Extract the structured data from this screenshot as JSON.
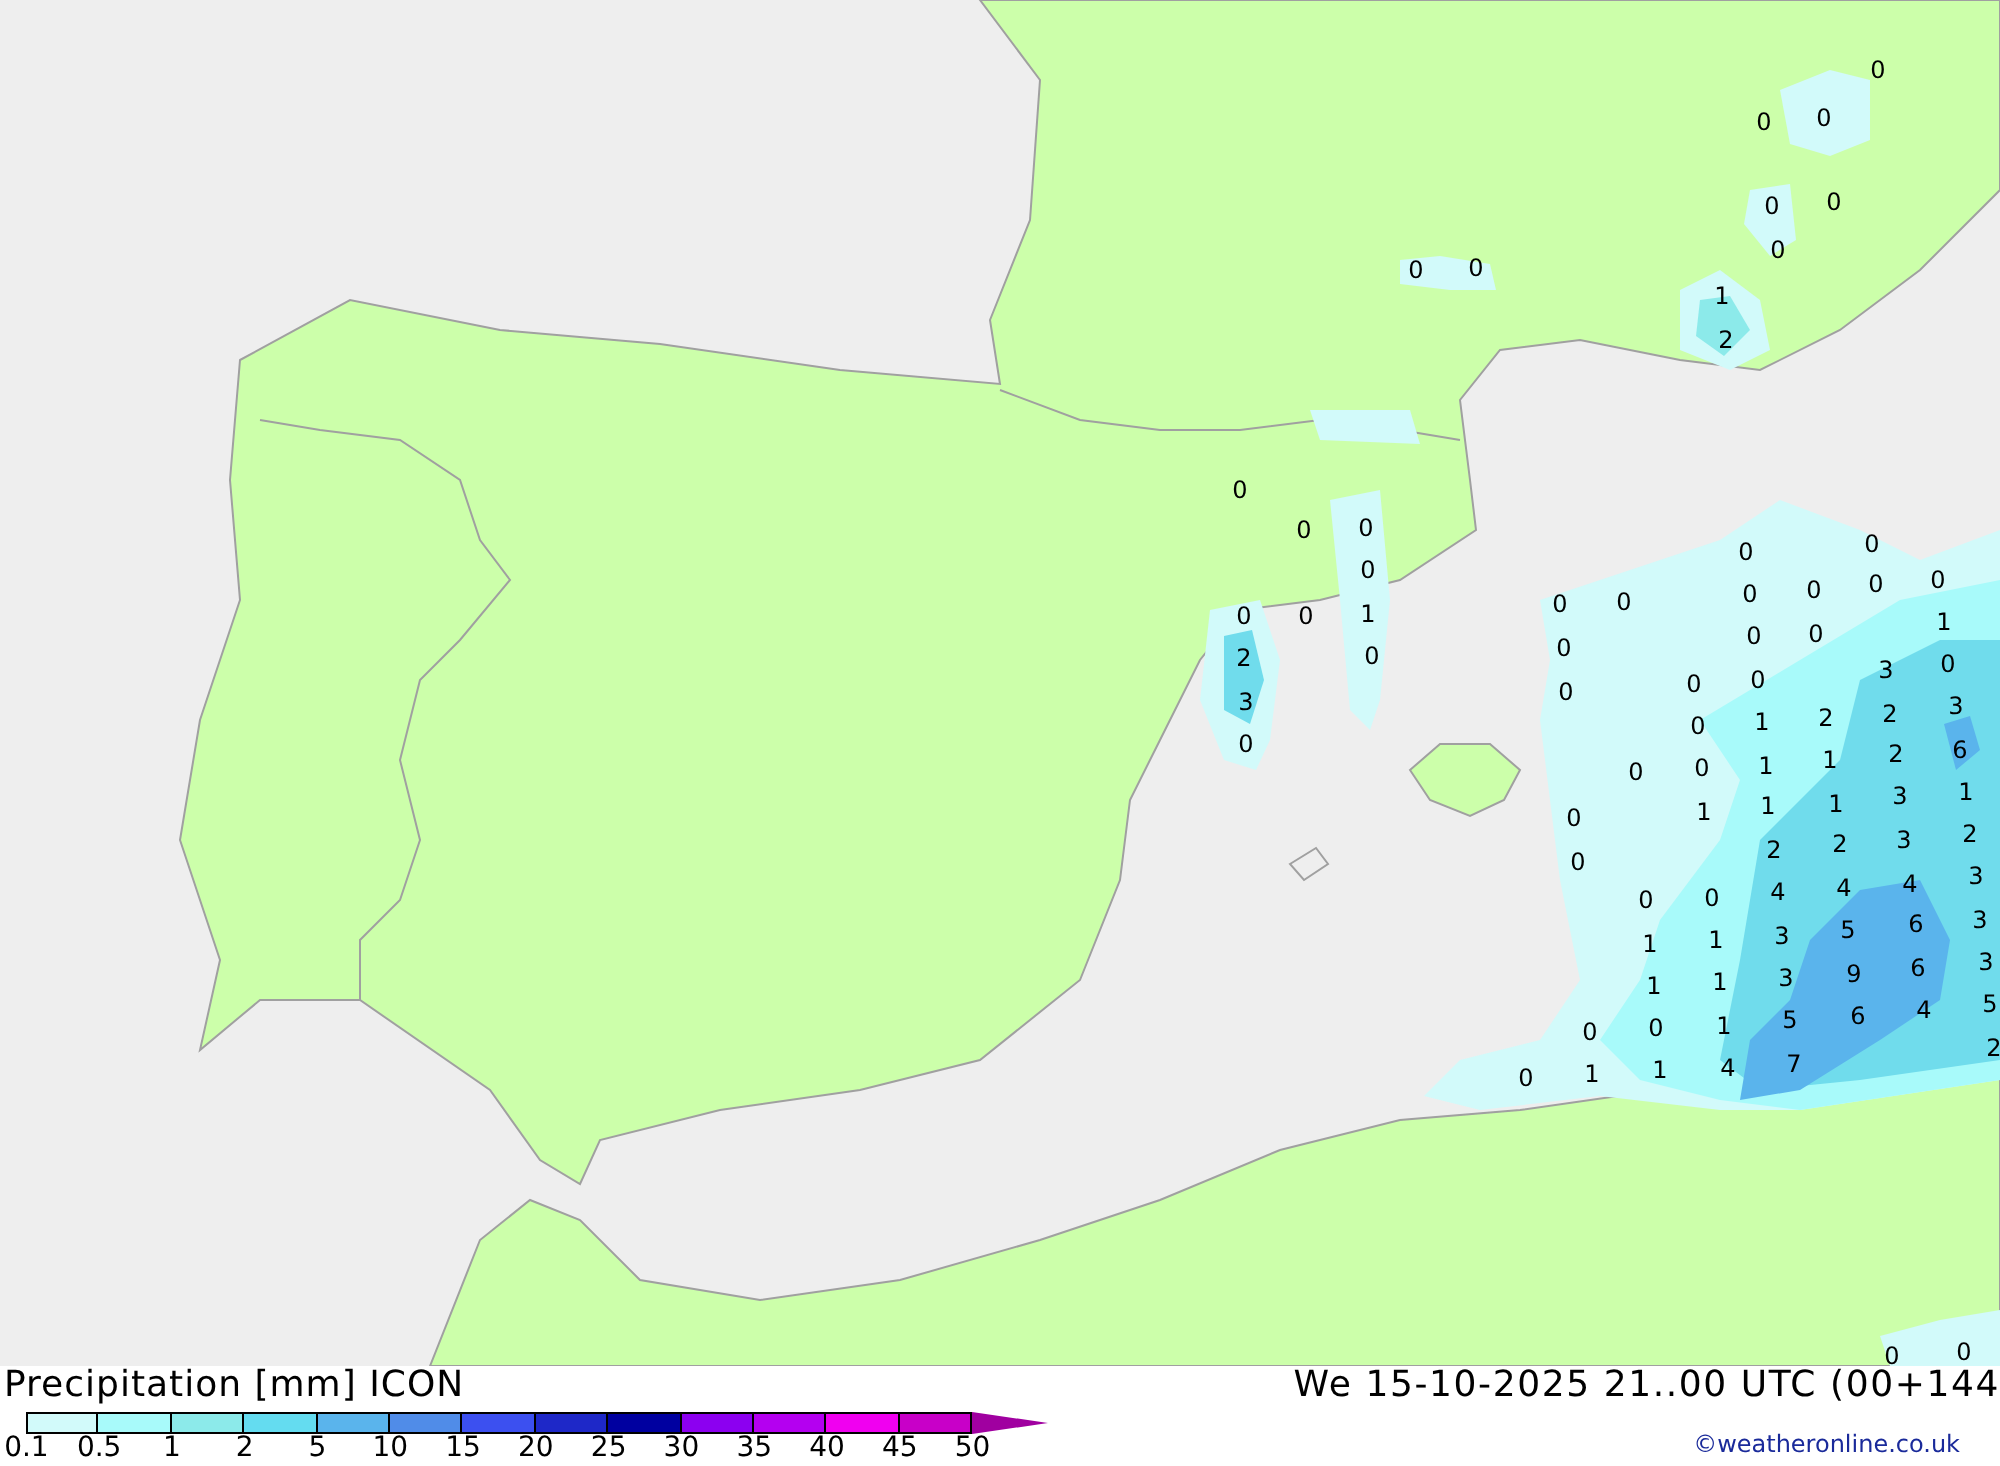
{
  "map": {
    "labels": [
      {
        "value": "0"
      },
      {
        "value": "0"
      },
      {
        "value": "0"
      },
      {
        "value": "0"
      },
      {
        "value": "0"
      },
      {
        "value": "0"
      },
      {
        "value": "0"
      },
      {
        "value": "0"
      },
      {
        "value": "1"
      },
      {
        "value": "2"
      },
      {
        "value": "0"
      },
      {
        "value": "0"
      },
      {
        "value": "0"
      },
      {
        "value": "0"
      },
      {
        "value": "0"
      },
      {
        "value": "0"
      },
      {
        "value": "0"
      },
      {
        "value": "0"
      },
      {
        "value": "0"
      },
      {
        "value": "0"
      },
      {
        "value": "0"
      },
      {
        "value": "0"
      },
      {
        "value": "0"
      },
      {
        "value": "0"
      },
      {
        "value": "1"
      },
      {
        "value": "1"
      },
      {
        "value": "0"
      },
      {
        "value": "0"
      },
      {
        "value": "0"
      },
      {
        "value": "2"
      },
      {
        "value": "0"
      },
      {
        "value": "3"
      },
      {
        "value": "0"
      },
      {
        "value": "0"
      },
      {
        "value": "0"
      },
      {
        "value": "0"
      },
      {
        "value": "3"
      },
      {
        "value": "3"
      },
      {
        "value": "0"
      },
      {
        "value": "1"
      },
      {
        "value": "2"
      },
      {
        "value": "2"
      },
      {
        "value": "0"
      },
      {
        "value": "1"
      },
      {
        "value": "2"
      },
      {
        "value": "6"
      },
      {
        "value": "0"
      },
      {
        "value": "0"
      },
      {
        "value": "1"
      },
      {
        "value": "3"
      },
      {
        "value": "1"
      },
      {
        "value": "1"
      },
      {
        "value": "1"
      },
      {
        "value": "1"
      },
      {
        "value": "0"
      },
      {
        "value": "3"
      },
      {
        "value": "2"
      },
      {
        "value": "2"
      },
      {
        "value": "2"
      },
      {
        "value": "0"
      },
      {
        "value": "4"
      },
      {
        "value": "3"
      },
      {
        "value": "0"
      },
      {
        "value": "0"
      },
      {
        "value": "4"
      },
      {
        "value": "4"
      },
      {
        "value": "6"
      },
      {
        "value": "3"
      },
      {
        "value": "1"
      },
      {
        "value": "1"
      },
      {
        "value": "3"
      },
      {
        "value": "5"
      },
      {
        "value": "6"
      },
      {
        "value": "3"
      },
      {
        "value": "1"
      },
      {
        "value": "1"
      },
      {
        "value": "3"
      },
      {
        "value": "9"
      },
      {
        "value": "4"
      },
      {
        "value": "5"
      },
      {
        "value": "0"
      },
      {
        "value": "0"
      },
      {
        "value": "1"
      },
      {
        "value": "5"
      },
      {
        "value": "6"
      },
      {
        "value": "2"
      },
      {
        "value": "0"
      },
      {
        "value": "1"
      },
      {
        "value": "1"
      },
      {
        "value": "4"
      },
      {
        "value": "7"
      },
      {
        "value": "0"
      },
      {
        "value": "0"
      }
    ]
  },
  "legend": {
    "title": "Precipitation [mm] ICON",
    "steps": [
      {
        "color": "#d2fafa"
      },
      {
        "color": "#a8fafa"
      },
      {
        "color": "#8ceaea"
      },
      {
        "color": "#64dcf0"
      },
      {
        "color": "#5ab4ec"
      },
      {
        "color": "#508ce8"
      },
      {
        "color": "#3c50f0"
      },
      {
        "color": "#1e28c8"
      },
      {
        "color": "#0000a0"
      },
      {
        "color": "#8c00f0"
      },
      {
        "color": "#b400f0"
      },
      {
        "color": "#f000f0"
      },
      {
        "color": "#c800c8"
      }
    ],
    "ticks": [
      "0.1",
      "0.5",
      "1",
      "2",
      "5",
      "10",
      "15",
      "20",
      "25",
      "30",
      "35",
      "40",
      "45",
      "50"
    ]
  },
  "valid_time": "We 15-10-2025 21..00 UTC (00+144",
  "credit": "©weatheronline.co.uk"
}
